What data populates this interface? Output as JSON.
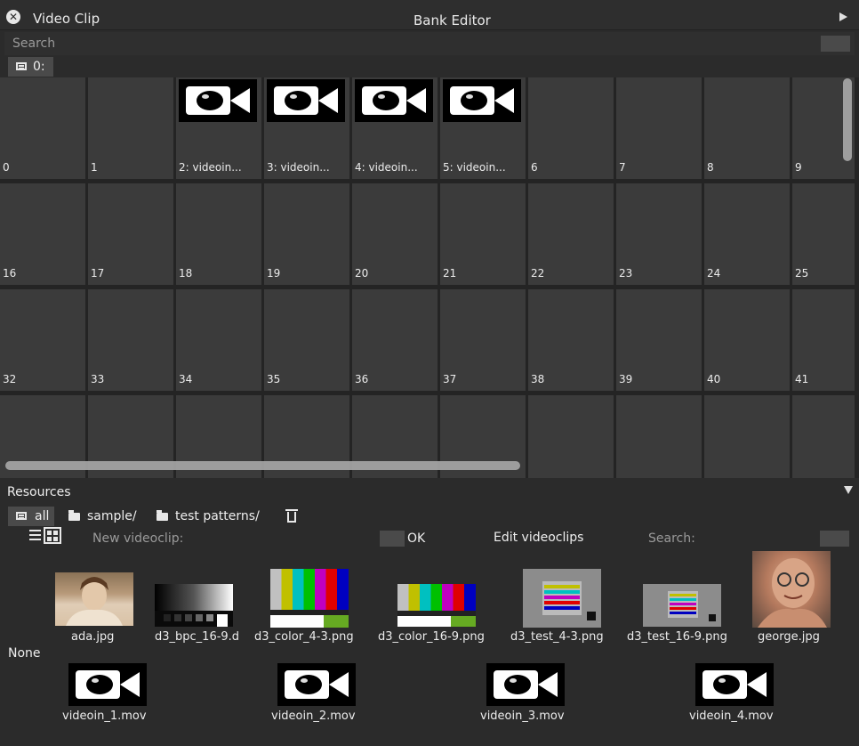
{
  "window": {
    "left_title": "Video Clip",
    "center_title": "Bank Editor"
  },
  "search": {
    "placeholder": "Search"
  },
  "bank": {
    "tab_label": "0:"
  },
  "grid": {
    "rows": [
      [
        "0",
        "1",
        "2: videoin...",
        "3: videoin...",
        "4: videoin...",
        "5: videoin...",
        "6",
        "7",
        "8",
        "9"
      ],
      [
        "16",
        "17",
        "18",
        "19",
        "20",
        "21",
        "22",
        "23",
        "24",
        "25"
      ],
      [
        "32",
        "33",
        "34",
        "35",
        "36",
        "37",
        "38",
        "39",
        "40",
        "41"
      ],
      [
        "",
        "",
        "",
        "",
        "",
        "",
        "",
        "",
        "",
        ""
      ]
    ],
    "camera_cells": [
      2,
      3,
      4,
      5
    ]
  },
  "resources": {
    "title": "Resources",
    "tabs": [
      {
        "label": "all",
        "icon": "list-icon"
      },
      {
        "label": "sample/",
        "icon": "folder-icon"
      },
      {
        "label": "test patterns/",
        "icon": "folder-icon"
      }
    ],
    "new_videoclip_label": "New videoclip:",
    "ok_label": "OK",
    "edit_label": "Edit videoclips",
    "search_label": "Search:",
    "none_label": "None",
    "images": [
      {
        "label": "ada.jpg",
        "kind": "photo-ada"
      },
      {
        "label": "d3_bpc_16-9.d",
        "kind": "gradient"
      },
      {
        "label": "d3_color_4-3.png",
        "kind": "colorbars"
      },
      {
        "label": "d3_color_16-9.png",
        "kind": "colorbars"
      },
      {
        "label": "d3_test_4-3.png",
        "kind": "testchart"
      },
      {
        "label": "d3_test_16-9.png",
        "kind": "testchart"
      },
      {
        "label": "george.jpg",
        "kind": "photo-george"
      }
    ],
    "videos": [
      {
        "label": "videoin_1.mov"
      },
      {
        "label": "videoin_2.mov"
      },
      {
        "label": "videoin_3.mov"
      },
      {
        "label": "videoin_4.mov"
      }
    ]
  },
  "colors": {
    "background": "#2b2b2b",
    "cell": "#3b3b3b",
    "accent_tab": "#4a4a4a",
    "text": "#e8e8e8"
  }
}
